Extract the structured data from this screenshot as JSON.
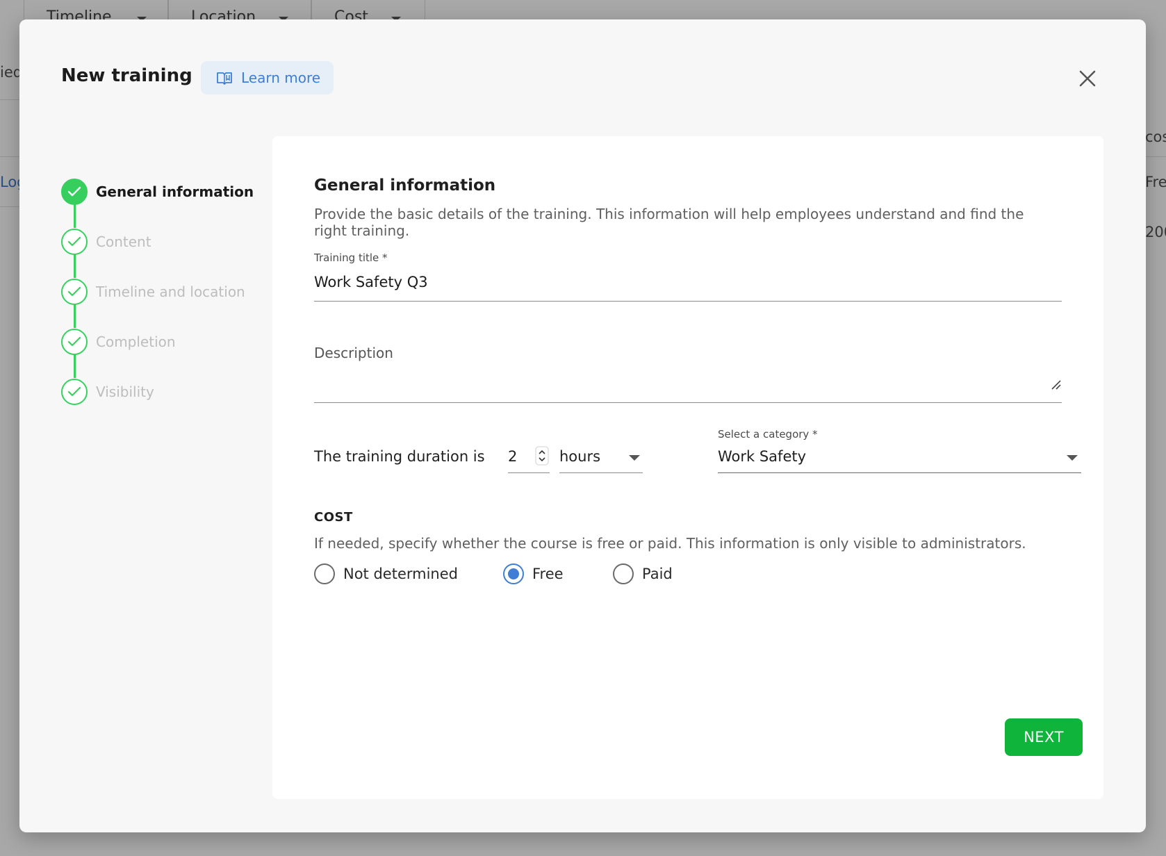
{
  "background": {
    "columns": [
      "Timeline",
      "Location",
      "Cost"
    ],
    "fragments": {
      "left_top": "ied",
      "left_link": "Log",
      "right_header": "cos",
      "right_row1": "Fre",
      "right_row2": "200"
    }
  },
  "modal": {
    "title": "New training",
    "learn_more": {
      "label": "Learn more",
      "icon": "book-icon"
    },
    "close_icon": "close-icon"
  },
  "stepper": {
    "steps": [
      {
        "label": "General information",
        "state": "current"
      },
      {
        "label": "Content",
        "state": "done"
      },
      {
        "label": "Timeline and location",
        "state": "done"
      },
      {
        "label": "Completion",
        "state": "done"
      },
      {
        "label": "Visibility",
        "state": "done"
      }
    ]
  },
  "form": {
    "section_title": "General information",
    "section_desc": "Provide the basic details of the training. This information will help employees understand and find the right training.",
    "training_title": {
      "label": "Training title *",
      "value": "Work Safety Q3"
    },
    "description": {
      "label": "Description",
      "value": ""
    },
    "duration": {
      "prefix": "The training duration is",
      "value": "2",
      "unit": "hours"
    },
    "category": {
      "label": "Select a category *",
      "value": "Work Safety"
    },
    "cost": {
      "title": "COST",
      "desc": "If needed, specify whether the course is free or paid. This information is only visible to administrators.",
      "options": [
        "Not determined",
        "Free",
        "Paid"
      ],
      "selected": "Free"
    },
    "next_label": "NEXT"
  },
  "colors": {
    "accent_blue": "#3f7ed4",
    "step_green": "#36cf5e",
    "next_green": "#0fb53a"
  }
}
